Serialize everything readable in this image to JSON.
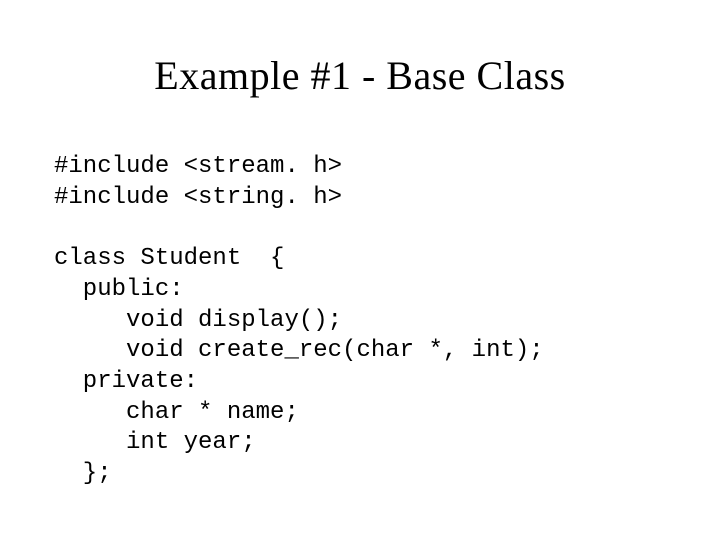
{
  "title": "Example #1 - Base Class",
  "code": {
    "l1": "#include <stream. h>",
    "l2": "#include <string. h>",
    "l3": "",
    "l4": "class Student  {",
    "l5": "  public:",
    "l6": "     void display();",
    "l7": "     void create_rec(char *, int);",
    "l8": "  private:",
    "l9": "     char * name;",
    "l10": "     int year;",
    "l11": "  };"
  }
}
